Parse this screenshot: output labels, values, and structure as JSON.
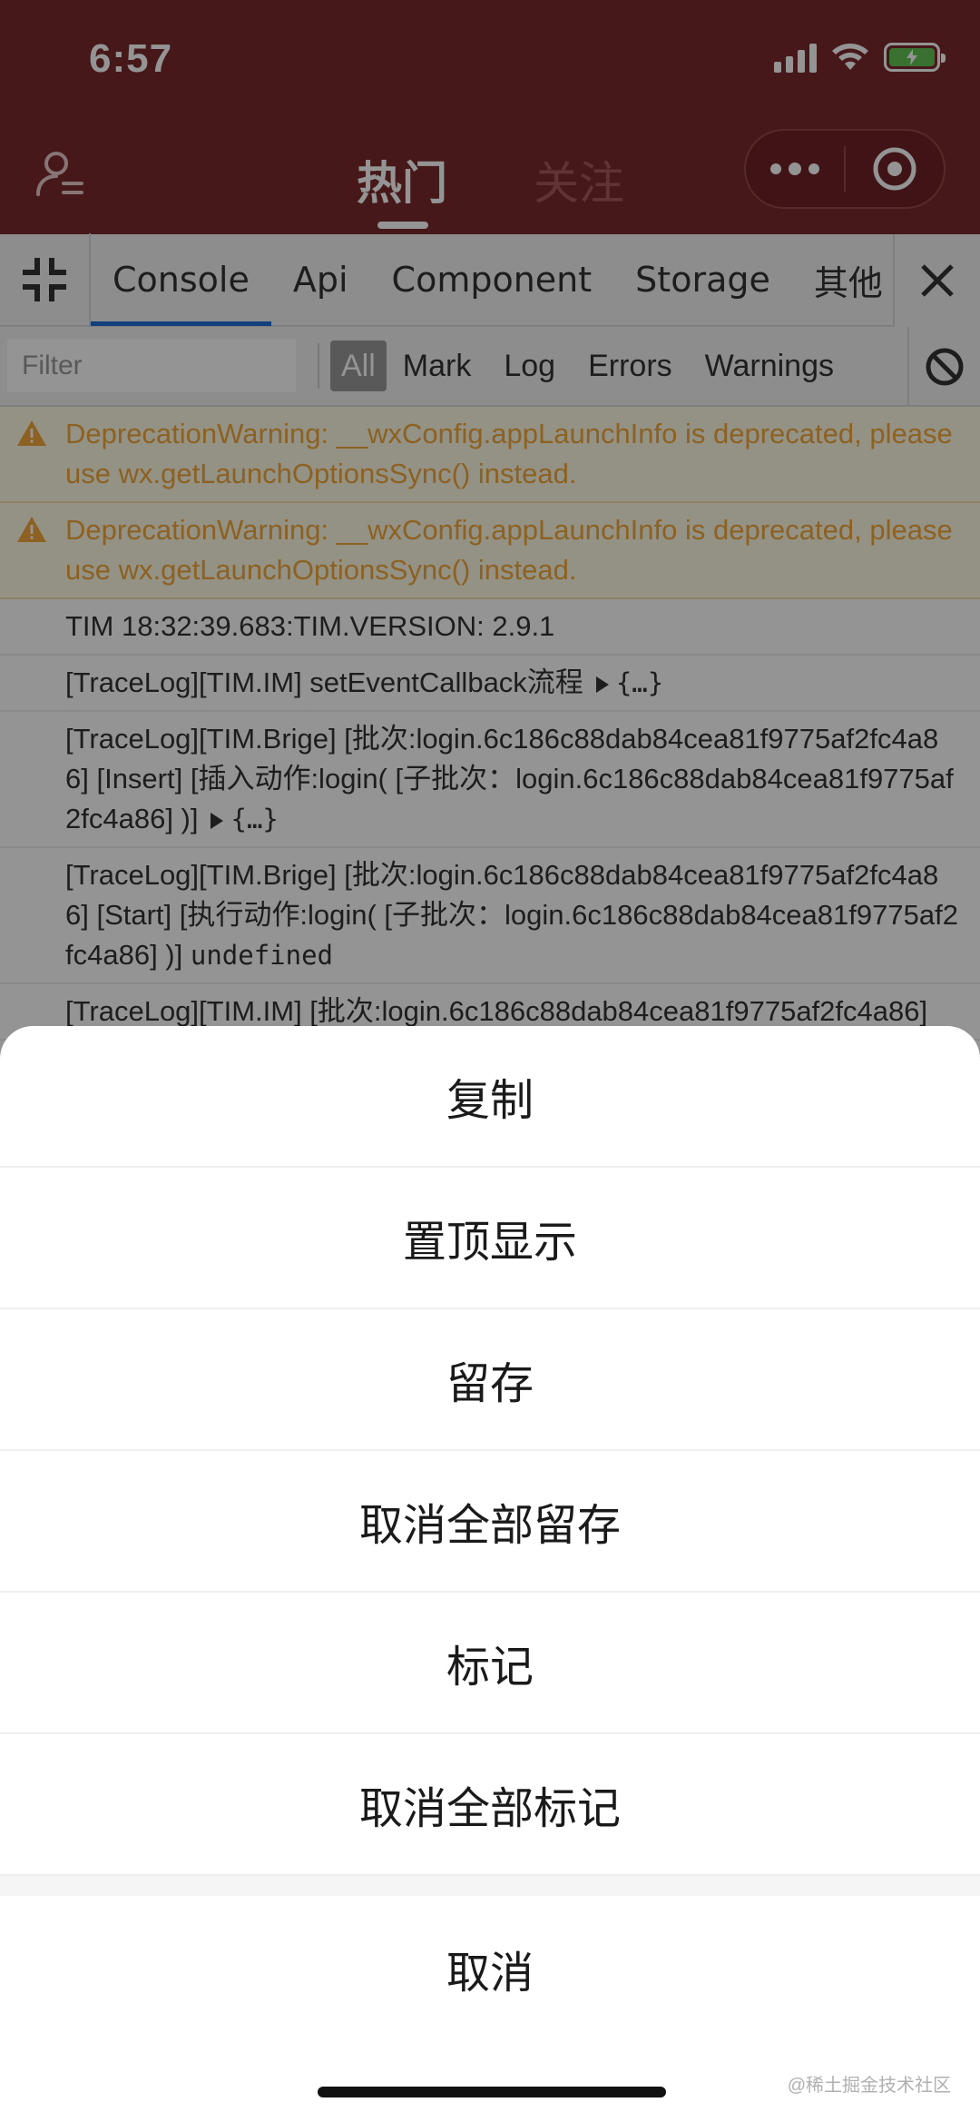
{
  "status_bar": {
    "time": "6:57"
  },
  "nav": {
    "tabs": [
      {
        "label": "热门",
        "active": true
      },
      {
        "label": "关注",
        "active": false
      }
    ]
  },
  "vconsole": {
    "tabs": [
      {
        "label": "Console",
        "active": true
      },
      {
        "label": "Api"
      },
      {
        "label": "Component"
      },
      {
        "label": "Storage"
      },
      {
        "label": "其他"
      }
    ],
    "filter": {
      "placeholder": "Filter",
      "levels": [
        {
          "label": "All",
          "active": true
        },
        {
          "label": "Mark"
        },
        {
          "label": "Log"
        },
        {
          "label": "Errors"
        },
        {
          "label": "Warnings"
        }
      ]
    },
    "logs": [
      {
        "type": "warn",
        "text": "DeprecationWarning: __wxConfig.appLaunchInfo is deprecated, please use wx.getLaunchOptionsSync() instead."
      },
      {
        "type": "warn",
        "text": "DeprecationWarning: __wxConfig.appLaunchInfo is deprecated, please use wx.getLaunchOptionsSync() instead."
      },
      {
        "type": "log",
        "text": "TIM 18:32:39.683:TIM.VERSION: 2.9.1"
      },
      {
        "type": "log",
        "text": "[TraceLog][TIM.IM] setEventCallback流程",
        "obj": "{…}"
      },
      {
        "type": "log",
        "text": "[TraceLog][TIM.Brige] [批次:login.6c186c88dab84cea81f9775af2fc4a86] [Insert] [插入动作:login( [子批次：login.6c186c88dab84cea81f9775af2fc4a86] )]",
        "obj": "{…}"
      },
      {
        "type": "log",
        "text": "[TraceLog][TIM.Brige] [批次:login.6c186c88dab84cea81f9775af2fc4a86] [Start] [执行动作:login( [子批次：login.6c186c88dab84cea81f9775af2fc4a86] )]",
        "mono": "undefined"
      },
      {
        "type": "log",
        "text": "[TraceLog][TIM.IM] [批次:login.6c186c88dab84cea81f9775af2fc4a86]"
      }
    ]
  },
  "action_sheet": {
    "items": [
      "复制",
      "置顶显示",
      "留存",
      "取消全部留存",
      "标记",
      "取消全部标记"
    ],
    "cancel": "取消"
  },
  "watermark": "@稀土掘金技术社区",
  "colors": {
    "header_bg": "#7b2a2c",
    "warning_text": "#f1a73c",
    "warning_bg": "#fffbe5",
    "accent_tab": "#1e6fd8"
  }
}
